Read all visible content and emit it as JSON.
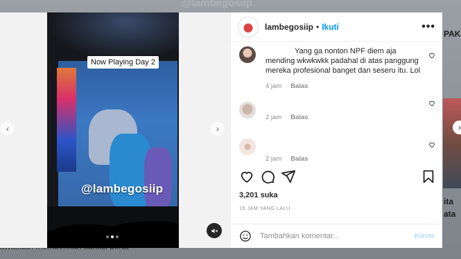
{
  "background": {
    "top_text": "@lambegosiip",
    "right_texts": [
      "PAK",
      "ita",
      "ata"
    ],
    "bottom_text": "awasaan memberikan sanksi berat"
  },
  "media": {
    "overlay_label": "Now Playing Day 2",
    "watermark": "@lambegosiip",
    "carousel": {
      "total": 3,
      "active": 2
    }
  },
  "post": {
    "username": "lambegosiip",
    "separator": "•",
    "follow_label": "Ikuti",
    "more_label": "•••",
    "comments": [
      {
        "text": "Yang ga nonton NPF diem aja mending wkwkwkk padahal di atas panggung mereka profesional banget dan seseru itu. Lol",
        "time": "4 jam",
        "reply_label": "Balas"
      },
      {
        "text": "",
        "time": "2 jam",
        "reply_label": "Balas"
      },
      {
        "text": "",
        "time": "2 jam",
        "reply_label": "Balas"
      }
    ],
    "likes": "3,201 suka",
    "posted_time": "15 JAM YANG LALU",
    "comment_placeholder": "Tambahkan komentar...",
    "post_label": "Kirim"
  },
  "colors": {
    "accent": "#0095f6",
    "accent_disabled": "#b2dffc",
    "text": "#262626",
    "muted": "#8e8e8e"
  },
  "icons": [
    "heart-icon",
    "comment-icon",
    "share-icon",
    "bookmark-icon",
    "emoji-icon",
    "mute-icon",
    "more-icon",
    "chevron-left-icon",
    "chevron-right-icon"
  ]
}
